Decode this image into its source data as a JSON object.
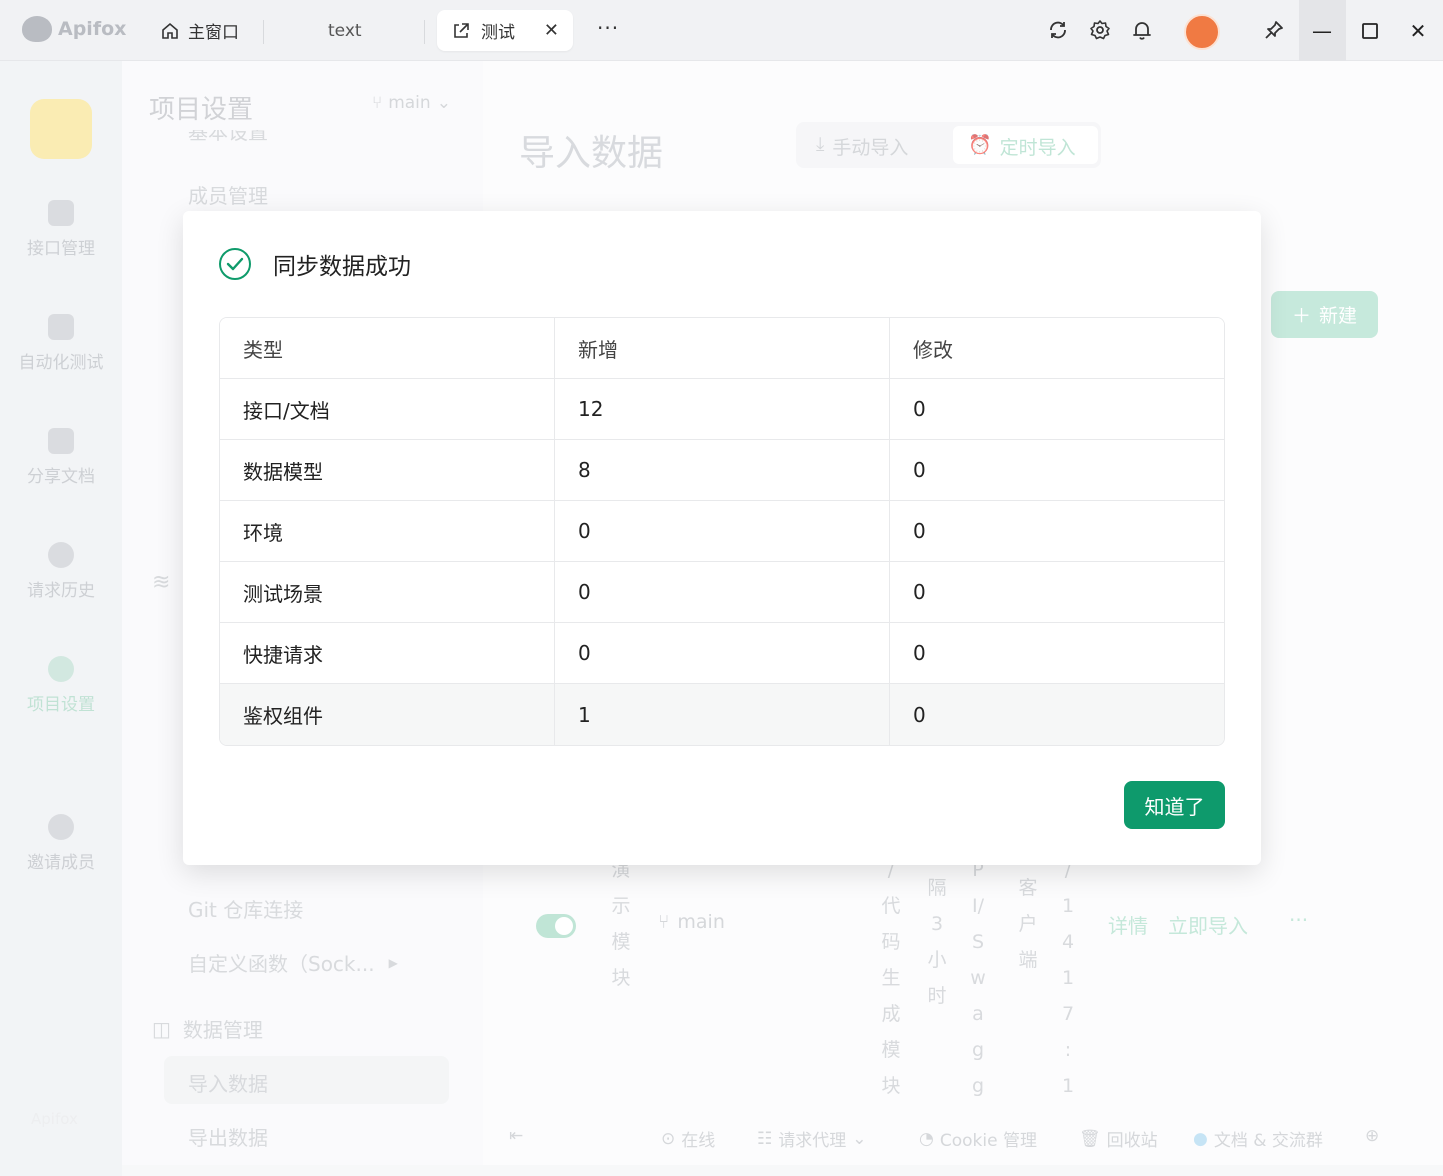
{
  "titlebar": {
    "brand": "Apifox",
    "tabs": [
      {
        "label": "主窗口"
      },
      {
        "label": "text"
      },
      {
        "label": "测试"
      }
    ],
    "more": "···"
  },
  "rail": {
    "items": [
      "接口管理",
      "自动化测试",
      "分享文档",
      "请求历史",
      "项目设置",
      "邀请成员"
    ],
    "footer": "Apifox"
  },
  "panel": {
    "title": "项目设置",
    "branch": "main",
    "cut_item": "基本设置",
    "member": "成员管理",
    "git": "Git 仓库连接",
    "custom_fn": "自定义函数（Sock...",
    "data_mgmt": "数据管理",
    "import": "导入数据",
    "export": "导出数据"
  },
  "content": {
    "heading": "导入数据",
    "seg_manual": "手动导入",
    "seg_timed": "定时导入",
    "new_btn": "新建",
    "row": {
      "name_chars": [
        "演",
        "示",
        "模",
        "块"
      ],
      "branch": "main",
      "scope_chars": [
        "/",
        "代",
        "码",
        "生",
        "成",
        "模",
        "块"
      ],
      "interval_chars": [
        "隔",
        "3",
        "小",
        "时"
      ],
      "source_chars": [
        "P",
        "I/",
        "S",
        "w",
        "a",
        "g",
        "g"
      ],
      "client_chars": [
        "客",
        "户",
        "端"
      ],
      "time_chars": [
        "/",
        "1",
        "4",
        "1",
        "7",
        ":",
        "1"
      ],
      "detail": "详情",
      "import_now": "立即导入",
      "more": "···"
    }
  },
  "bottombar": {
    "online": "在线",
    "proxy": "请求代理",
    "cookie": "Cookie 管理",
    "trash": "回收站",
    "docs": "文档 & 交流群"
  },
  "modal": {
    "title": "同步数据成功",
    "headers": [
      "类型",
      "新增",
      "修改"
    ],
    "rows": [
      {
        "type": "接口/文档",
        "added": "12",
        "modified": "0"
      },
      {
        "type": "数据模型",
        "added": "8",
        "modified": "0"
      },
      {
        "type": "环境",
        "added": "0",
        "modified": "0"
      },
      {
        "type": "测试场景",
        "added": "0",
        "modified": "0"
      },
      {
        "type": "快捷请求",
        "added": "0",
        "modified": "0"
      },
      {
        "type": "鉴权组件",
        "added": "1",
        "modified": "0"
      }
    ],
    "ok_button": "知道了"
  },
  "colors": {
    "accent": "#0e9a6c",
    "accent_faded": "#a8ddc9"
  }
}
